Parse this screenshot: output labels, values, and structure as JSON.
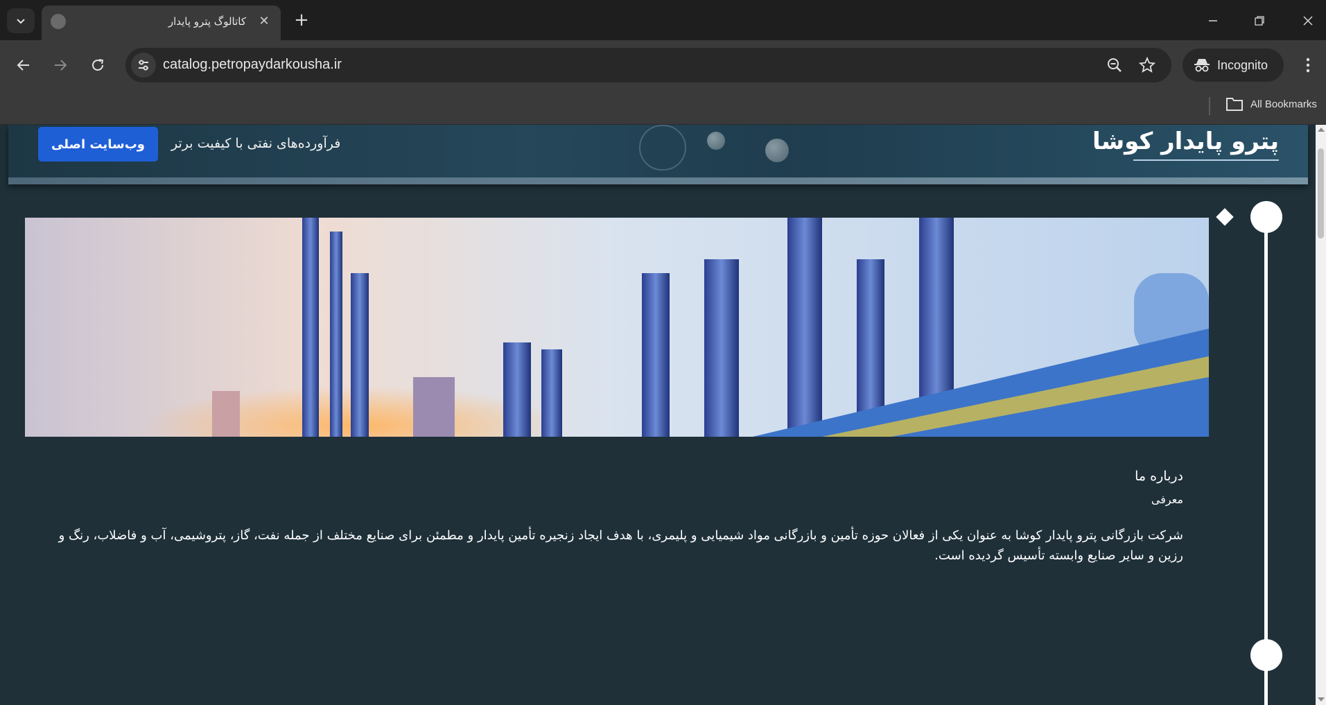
{
  "browser": {
    "tab_title": "کاتالوگ پترو پایدار",
    "url": "catalog.petropaydarkousha.ir",
    "incognito_label": "Incognito",
    "all_bookmarks_label": "All Bookmarks"
  },
  "header": {
    "brand": "پترو پایدار کوشا",
    "tagline": "فرآورده‌های نفتی با کیفیت برتر",
    "main_site_button": "وب‌سایت اصلی"
  },
  "about": {
    "title": "درباره ما",
    "subtitle": "معرفی",
    "body": "شرکت بازرگانی پترو پایدار کوشا به عنوان یکی از فعالان حوزه تأمین و بازرگانی مواد شیمیایی و پلیمری، با هدف ایجاد زنجیره تأمین پایدار و مطمئن برای صنایع مختلف از جمله نفت، گاز، پتروشیمی، آب و فاضلاب، رنگ و رزین و سایر صنایع وابسته تأسیس گردیده است."
  },
  "colors": {
    "page_background": "#1f3039",
    "primary_button": "#1f5fd6",
    "chrome_dark": "#1e1e1e",
    "chrome_toolbar": "#3a3a3a"
  }
}
